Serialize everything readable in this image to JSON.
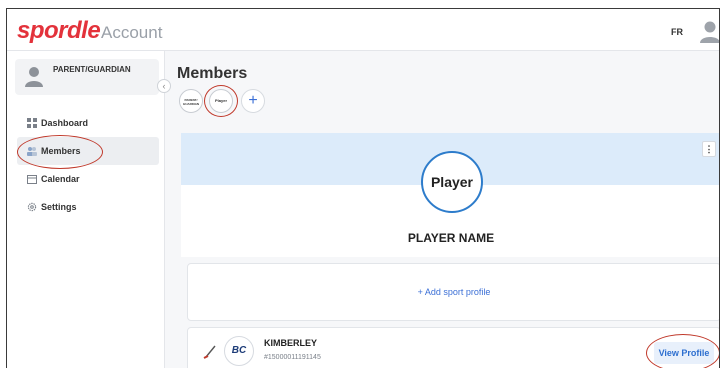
{
  "header": {
    "logo": "spordle",
    "logo_sub": "Account",
    "language": "FR"
  },
  "sidebar": {
    "user_role": "PARENT/GUARDIAN",
    "collapse_glyph": "‹",
    "items": [
      {
        "label": "Dashboard",
        "icon": "dashboard-icon"
      },
      {
        "label": "Members",
        "icon": "members-icon"
      },
      {
        "label": "Calendar",
        "icon": "calendar-icon"
      },
      {
        "label": "Settings",
        "icon": "gear-icon"
      }
    ]
  },
  "main": {
    "title": "Members",
    "tabs": [
      {
        "label": "PARENT/ GUARDIAN"
      },
      {
        "label": "Player"
      }
    ],
    "add_glyph": "+"
  },
  "profile": {
    "avatar_label": "Player",
    "name": "PLAYER NAME",
    "menu_glyph": "⋮"
  },
  "add_sport": {
    "label": "+ Add sport profile"
  },
  "sport_profile": {
    "org_logo_text": "BC",
    "name": "KIMBERLEY",
    "id": "#15000011191145",
    "view_label": "View Profile"
  },
  "colors": {
    "brand": "#e3323b",
    "accent": "#3b6fd6",
    "highlight_ring": "#c0392b",
    "banner": "#dcebfa"
  }
}
